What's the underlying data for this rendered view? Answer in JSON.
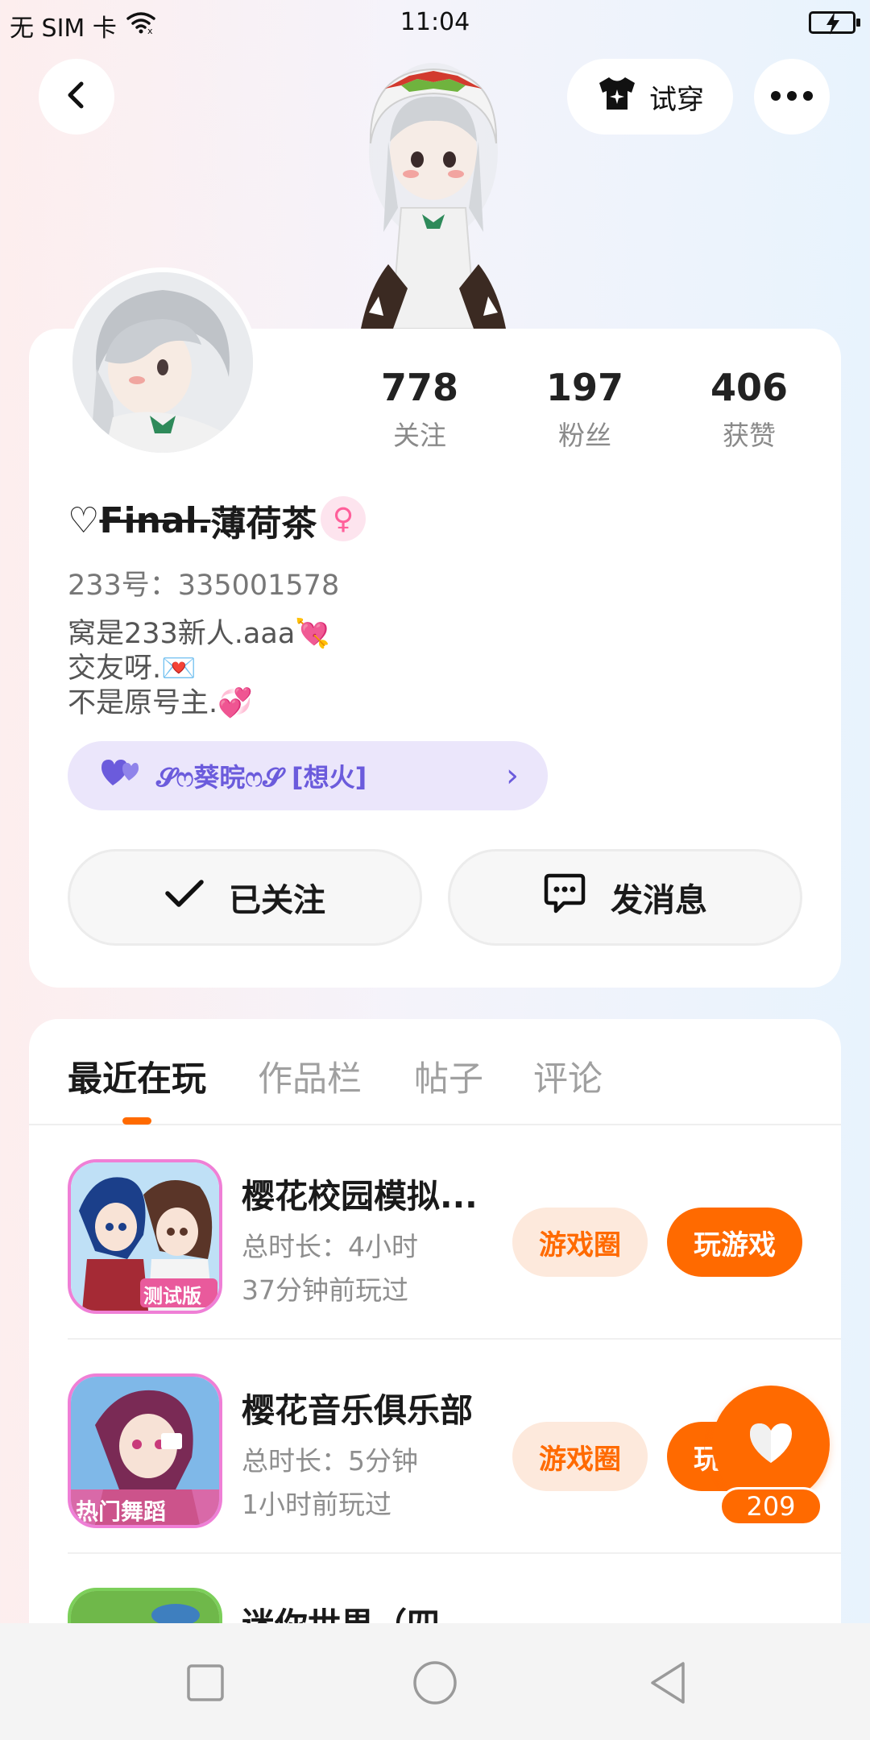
{
  "status_bar": {
    "carrier": "无 SIM 卡",
    "time": "11:04"
  },
  "header": {
    "try_on_label": "试穿"
  },
  "profile": {
    "stats": [
      {
        "value": "778",
        "label": "关注"
      },
      {
        "value": "197",
        "label": "粉丝"
      },
      {
        "value": "406",
        "label": "获赞"
      }
    ],
    "nickname_prefix": "♡",
    "nickname_strike": "Final.",
    "nickname_main": "薄荷茶",
    "gender_symbol": "♀",
    "uid": "233号：335001578",
    "bio": [
      "窝是233新人.aaa💘",
      "交友呀.💌",
      "不是原号主.💞"
    ],
    "cp_tag": {
      "text": "𝓢ෆ葵晥ෆ𝓢 [想火]"
    },
    "follow_label": "已关注",
    "message_label": "发消息"
  },
  "tabs": [
    {
      "label": "最近在玩",
      "active": true
    },
    {
      "label": "作品栏",
      "active": false
    },
    {
      "label": "帖子",
      "active": false
    },
    {
      "label": "评论",
      "active": false
    }
  ],
  "games": [
    {
      "title": "樱花校园模拟...",
      "duration": "总时长：4小时",
      "last_played": "37分钟前玩过",
      "icon_badge": "测试版",
      "circle_label": "游戏圈",
      "play_label": "玩游戏"
    },
    {
      "title": "樱花音乐俱乐部",
      "duration": "总时长：5分钟",
      "last_played": "1小时前玩过",
      "icon_badge": "热门舞蹈",
      "circle_label": "游戏圈",
      "play_label": "玩游戏"
    },
    {
      "title": "迷你世界（四",
      "duration": "",
      "last_played": "",
      "icon_badge": "",
      "circle_label": "",
      "play_label": ""
    }
  ],
  "like_fab": {
    "count": "209"
  },
  "colors": {
    "accent": "#ff6a00",
    "accent_light": "#fde9dc",
    "tag_bg": "#ebe6fb",
    "tag_text": "#6b5bdc",
    "gender_pink": "#ff5f9a"
  }
}
